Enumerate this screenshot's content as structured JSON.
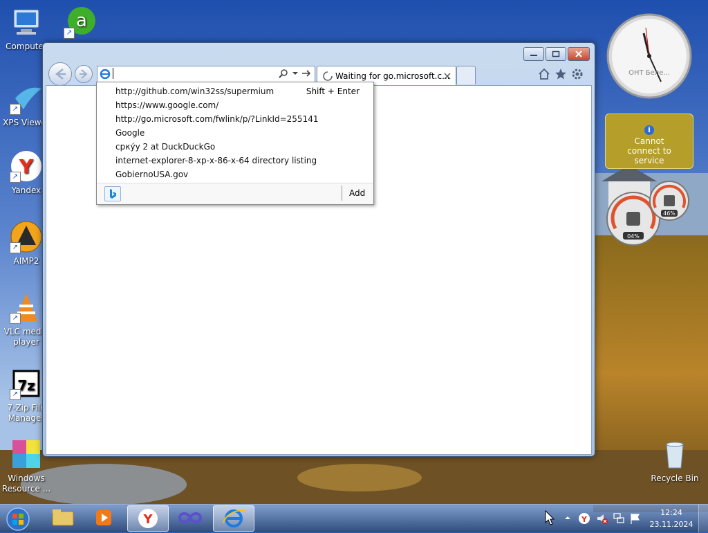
{
  "desktop": {
    "icons": [
      {
        "label": "Computer"
      },
      {
        "label": ""
      },
      {
        "label": "XPS Viewer"
      },
      {
        "label": "Yandex"
      },
      {
        "label": "AIMP2"
      },
      {
        "label": "VLC media player"
      },
      {
        "label": "7-Zip File Manager"
      },
      {
        "label": "Windows Resource ..."
      },
      {
        "label": "Recycle Bin"
      }
    ]
  },
  "gadgets": {
    "clock_label": "ОНТ Беле...",
    "weather_message": "Cannot connect to service",
    "cpu_percent": "04%",
    "memory_percent": "46%"
  },
  "browser": {
    "address_value": "",
    "tab_title": "Waiting for go.microsoft.c...",
    "suggestions": [
      "http://github.com/win32ss/supermium",
      "https://www.google.com/",
      "http://go.microsoft.com/fwlink/p/?LinkId=255141",
      "Google",
      "срку́у 2 at DuckDuckGo",
      "internet-explorer-8-xp-x-86-x-64 directory listing",
      "GobiernoUSA.gov"
    ],
    "shortcut_hint": "Shift + Enter",
    "add_label": "Add"
  },
  "taskbar": {
    "time": "12:24",
    "date": "23.11.2024"
  }
}
